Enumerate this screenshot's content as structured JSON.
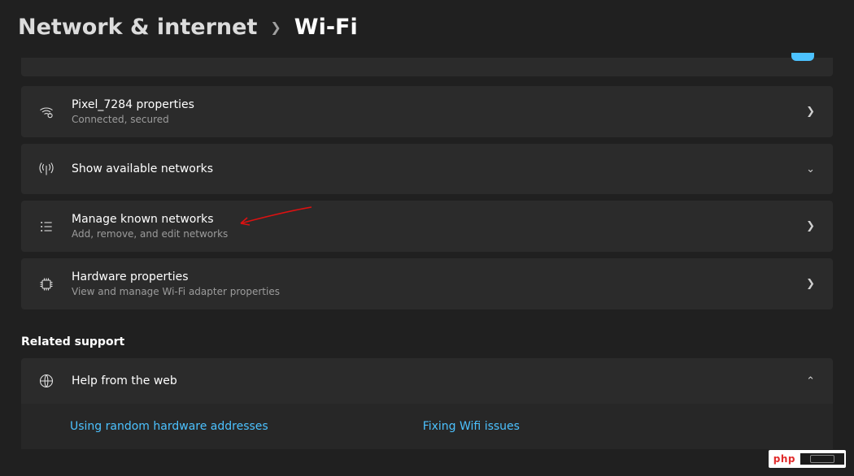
{
  "breadcrumb": {
    "parent": "Network & internet",
    "current": "Wi-Fi"
  },
  "cards": {
    "wifi_net": {
      "title": "Pixel_7284 properties",
      "subtitle": "Connected, secured"
    },
    "available": {
      "title": "Show available networks"
    },
    "known": {
      "title": "Manage known networks",
      "subtitle": "Add, remove, and edit networks"
    },
    "hardware": {
      "title": "Hardware properties",
      "subtitle": "View and manage Wi-Fi adapter properties"
    }
  },
  "related_support": {
    "label": "Related support",
    "help_title": "Help from the web",
    "links": {
      "addresses": "Using random hardware addresses",
      "fixing": "Fixing Wifi issues"
    }
  },
  "watermark": {
    "text": "php"
  }
}
